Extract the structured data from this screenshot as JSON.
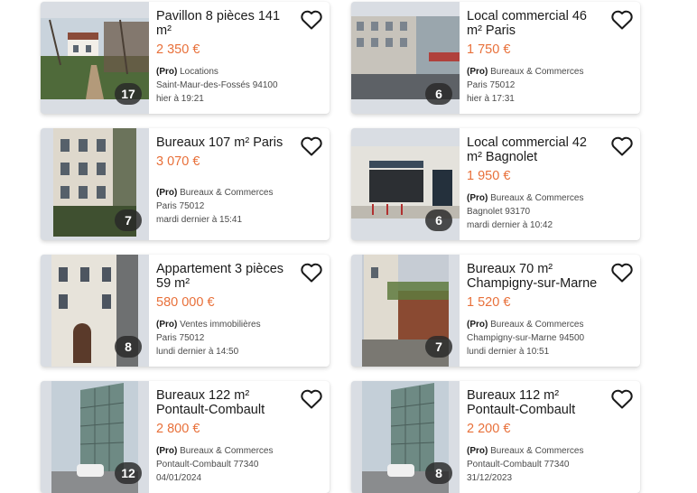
{
  "listings": [
    {
      "title": "Pavillon 8 pièces 141 m²",
      "price": "2 350 €",
      "pro_label": "(Pro)",
      "category": "Locations",
      "location": "Saint-Maur-des-Fossés 94100",
      "date": "hier à 19:21",
      "photo_count": "17",
      "favorite_icon": "heart-outline-icon"
    },
    {
      "title": "Local commercial 46 m² Paris",
      "price": "1 750 €",
      "pro_label": "(Pro)",
      "category": "Bureaux & Commerces",
      "location": "Paris 75012",
      "date": "hier à 17:31",
      "photo_count": "6",
      "favorite_icon": "heart-outline-icon"
    },
    {
      "title": "Bureaux 107 m² Paris",
      "price": "3 070 €",
      "pro_label": "(Pro)",
      "category": "Bureaux & Commerces",
      "location": "Paris 75012",
      "date": "mardi dernier à 15:41",
      "photo_count": "7",
      "favorite_icon": "heart-outline-icon"
    },
    {
      "title": "Local commercial 42 m² Bagnolet",
      "price": "1 950 €",
      "pro_label": "(Pro)",
      "category": "Bureaux & Commerces",
      "location": "Bagnolet 93170",
      "date": "mardi dernier à 10:42",
      "photo_count": "6",
      "favorite_icon": "heart-outline-icon"
    },
    {
      "title": "Appartement 3 pièces 59 m²",
      "price": "580 000 €",
      "pro_label": "(Pro)",
      "category": "Ventes immobilières",
      "location": "Paris 75012",
      "date": "lundi dernier à 14:50",
      "photo_count": "8",
      "favorite_icon": "heart-outline-icon"
    },
    {
      "title": "Bureaux 70 m² Champigny-sur-Marne",
      "price": "1 520 €",
      "pro_label": "(Pro)",
      "category": "Bureaux & Commerces",
      "location": "Champigny-sur-Marne 94500",
      "date": "lundi dernier à 10:51",
      "photo_count": "7",
      "favorite_icon": "heart-outline-icon"
    },
    {
      "title": "Bureaux 122 m² Pontault-Combault",
      "price": "2 800 €",
      "pro_label": "(Pro)",
      "category": "Bureaux & Commerces",
      "location": "Pontault-Combault 77340",
      "date": "04/01/2024",
      "photo_count": "12",
      "favorite_icon": "heart-outline-icon"
    },
    {
      "title": "Bureaux 112 m² Pontault-Combault",
      "price": "2 200 €",
      "pro_label": "(Pro)",
      "category": "Bureaux & Commerces",
      "location": "Pontault-Combault 77340",
      "date": "31/12/2023",
      "photo_count": "8",
      "favorite_icon": "heart-outline-icon"
    }
  ],
  "colors": {
    "price": "#e8703a",
    "heart": "#1a1a1a",
    "badge": "#282828"
  }
}
